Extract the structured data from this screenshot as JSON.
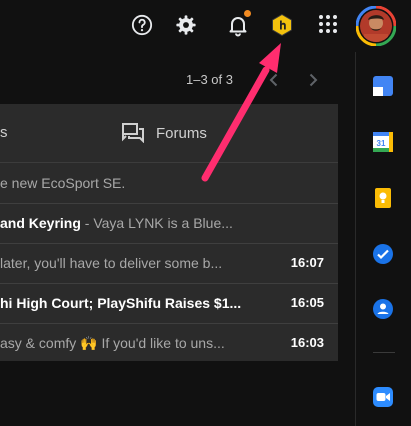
{
  "pagination": {
    "range": "1–3 of 3"
  },
  "tabs": {
    "partial_label": "s",
    "forums_label": "Forums"
  },
  "rows": [
    {
      "sender": "",
      "subject": "",
      "snippet": "e new EcoSport SE.",
      "time": ""
    },
    {
      "sender": "",
      "subject": " and Keyring",
      "snippet": " - Vaya LYNK is a Blue...",
      "time": ""
    },
    {
      "sender": "",
      "subject": "",
      "snippet": "later, you'll have to deliver some b...",
      "time": "16:07"
    },
    {
      "sender": "",
      "subject": "hi High Court; PlayShifu Raises $1...",
      "snippet": "",
      "time": "16:05"
    },
    {
      "sender": "",
      "subject": "",
      "snippet": "asy & comfy 🙌 If you'd like to uns...",
      "time": "16:03"
    }
  ],
  "colors": {
    "accent_pink": "#ff2d6f",
    "notification_dot": "#f28b22",
    "extension_yellow": "#f4c20d"
  },
  "icons": {
    "help": "help-icon",
    "settings": "gear-icon",
    "notifications": "bell-icon",
    "extension": "hexagon-extension-icon",
    "apps": "apps-grid-icon",
    "keep": "keep-icon",
    "calendar": "calendar-icon",
    "calendar_number": "31",
    "tasks": "tasks-icon",
    "contacts": "contacts-icon",
    "zoom": "zoom-icon"
  }
}
